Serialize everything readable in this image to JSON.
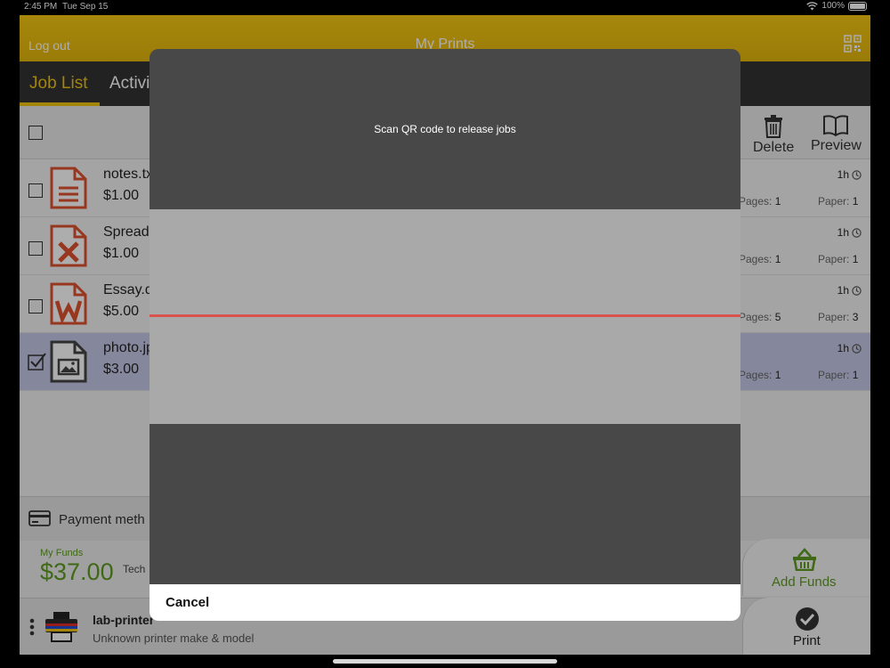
{
  "status_bar": {
    "time": "2:45 PM",
    "date": "Tue Sep 15",
    "battery": "100%"
  },
  "header": {
    "logout_label": "Log out",
    "title": "My Prints"
  },
  "tabs": [
    {
      "label": "Job List"
    },
    {
      "label": "Activi"
    }
  ],
  "toolbar": {
    "delete_label": "Delete",
    "preview_label": "Preview"
  },
  "jobs": [
    {
      "name": "notes.tx",
      "price": "$1.00",
      "age": "1h",
      "pages_label": "Pages:",
      "pages": "1",
      "paper_label": "Paper:",
      "paper": "1",
      "icon": "text-file-icon",
      "selected": false
    },
    {
      "name": "Spread",
      "price": "$1.00",
      "age": "1h",
      "pages_label": "Pages:",
      "pages": "1",
      "paper_label": "Paper:",
      "paper": "1",
      "icon": "excel-file-icon",
      "selected": false
    },
    {
      "name": "Essay.d",
      "price": "$5.00",
      "age": "1h",
      "pages_label": "Pages:",
      "pages": "5",
      "paper_label": "Paper:",
      "paper": "3",
      "icon": "word-file-icon",
      "selected": false
    },
    {
      "name": "photo.jp",
      "price": "$3.00",
      "age": "1h",
      "pages_label": "Pages:",
      "pages": "1",
      "paper_label": "Paper:",
      "paper": "1",
      "icon": "image-file-icon",
      "selected": true
    }
  ],
  "payment": {
    "label": "Payment meth"
  },
  "funds": {
    "caption": "My Funds",
    "amount": "$37.00",
    "account": "Tech",
    "add_label": "Add Funds"
  },
  "printer": {
    "name": "lab-printer",
    "model": "Unknown printer make & model",
    "print_label": "Print"
  },
  "modal": {
    "instruction": "Scan QR code to release jobs",
    "cancel_label": "Cancel"
  },
  "colors": {
    "brand_yellow": "#f1c40f",
    "funds_green": "#5e9a23",
    "scan_line": "#d9534f",
    "selected_row": "#c5c8e8"
  }
}
